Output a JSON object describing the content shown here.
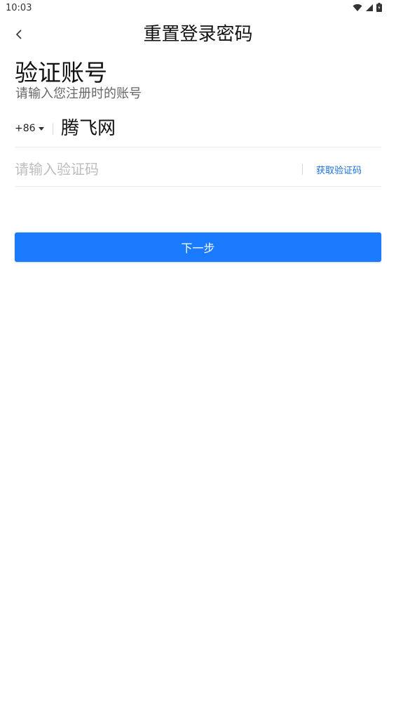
{
  "status_bar": {
    "time": "10:03",
    "icons": [
      "wifi-icon",
      "signal-icon",
      "battery-icon"
    ]
  },
  "app_bar": {
    "back_icon": "chevron-left-icon",
    "title": "重置登录密码"
  },
  "heading": "验证账号",
  "subheading": "请输入您注册时的账号",
  "phone": {
    "country_code": "+86",
    "dropdown_icon": "caret-down-icon",
    "value": "腾飞网"
  },
  "verification": {
    "placeholder": "请输入验证码",
    "value": "",
    "get_code_label": "获取验证码"
  },
  "next_button_label": "下一步",
  "colors": {
    "accent": "#1a7bff",
    "link": "#1a6fd8",
    "placeholder": "#bdbdbd",
    "divider": "#ececec"
  }
}
